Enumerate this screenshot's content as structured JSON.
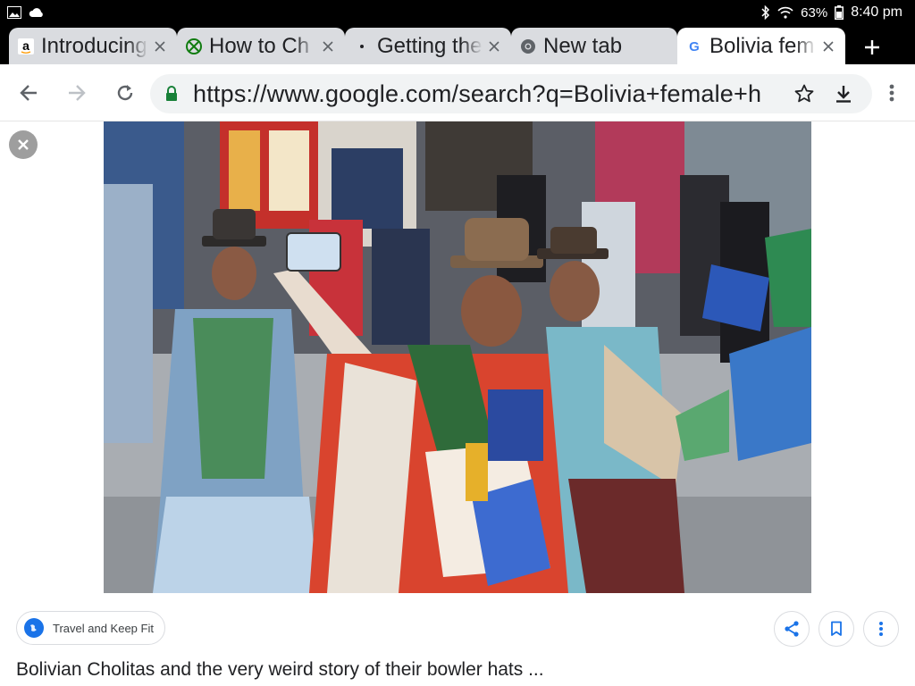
{
  "status_bar": {
    "battery": "63%",
    "time": "8:40 pm"
  },
  "tabs": [
    {
      "title": "Introducing",
      "favicon": "amazon-a-icon"
    },
    {
      "title": "How to Ch",
      "favicon": "xbox-icon"
    },
    {
      "title": "Getting the",
      "favicon": "dot-icon"
    },
    {
      "title": "New tab",
      "favicon": "chrome-icon"
    },
    {
      "title": "Bolivia fem",
      "favicon": "google-g-icon",
      "active": true
    }
  ],
  "toolbar": {
    "url": "https://www.google.com/search?q=Bolivia+female+h"
  },
  "result": {
    "source": "Travel and Keep Fit",
    "caption": "Bolivian Cholitas and the very weird story of their bowler hats ..."
  },
  "colors": {
    "accent": "#1a73e8",
    "lock": "#188038",
    "tab_inactive": "#dadce0"
  }
}
